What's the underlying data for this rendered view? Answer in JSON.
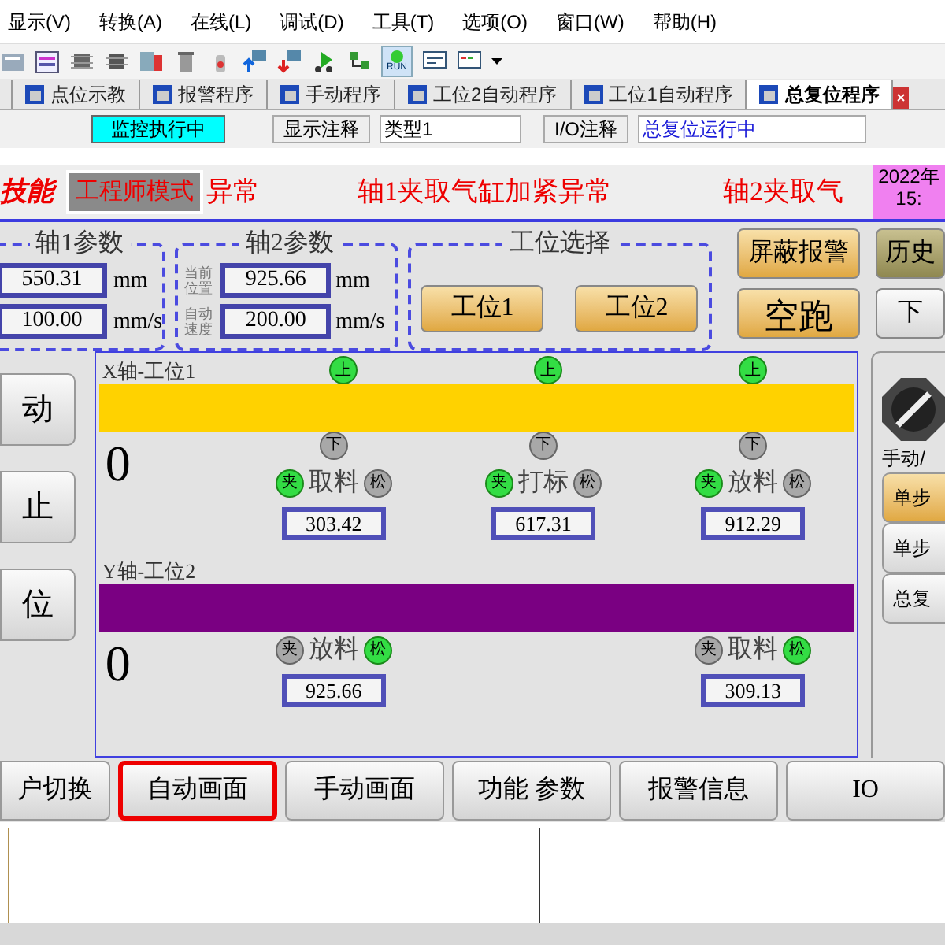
{
  "menu": [
    "显示(V)",
    "转换(A)",
    "在线(L)",
    "调试(D)",
    "工具(T)",
    "选项(O)",
    "窗口(W)",
    "帮助(H)"
  ],
  "toolbar": {
    "run_label": "RUN"
  },
  "tabs": [
    {
      "label": "点位示教",
      "selected": false
    },
    {
      "label": "报警程序",
      "selected": false
    },
    {
      "label": "手动程序",
      "selected": false
    },
    {
      "label": "工位2自动程序",
      "selected": false
    },
    {
      "label": "工位1自动程序",
      "selected": false
    },
    {
      "label": "总复位程序",
      "selected": true
    }
  ],
  "monitor": {
    "status": "监控执行中",
    "comment_button": "显示注释",
    "type_select": "类型1",
    "io_button": "I/O注释",
    "message": "总复位运行中"
  },
  "alarm_bar": {
    "logo_text": "技能",
    "mode_button": "工程师模式",
    "messages": [
      "异常",
      "轴1夹取气缸加紧异常",
      "轴2夹取气"
    ],
    "date": "2022年",
    "time": "15:"
  },
  "axis1": {
    "title": "轴1参数",
    "fields": [
      {
        "value": "550.31",
        "unit": "mm"
      },
      {
        "value": "100.00",
        "unit": "mm/s"
      }
    ]
  },
  "axis2": {
    "title": "轴2参数",
    "fields": [
      {
        "label": "当前位置",
        "value": "925.66",
        "unit": "mm"
      },
      {
        "label": "自动速度",
        "value": "200.00",
        "unit": "mm/s"
      }
    ]
  },
  "station_select": {
    "title": "工位选择",
    "buttons": [
      "工位1",
      "工位2"
    ]
  },
  "top_buttons": [
    {
      "label": "屏蔽报警",
      "kind": "gold"
    },
    {
      "label": "历史",
      "kind": "olive"
    },
    {
      "label": "空跑",
      "kind": "gold"
    },
    {
      "label": "下",
      "kind": "gray"
    }
  ],
  "control_buttons": [
    "动",
    "止",
    "位"
  ],
  "sections": [
    {
      "title": "X轴-工位1",
      "color": "#ffd200",
      "count": "0",
      "stations": [
        {
          "upper": {
            "text": "上",
            "on": true
          },
          "lower": {
            "text": "下",
            "on": false
          },
          "clamp": {
            "text": "夹",
            "on": true
          },
          "release": {
            "text": "松",
            "on": false
          },
          "name": "取料",
          "value": "303.42"
        },
        {
          "upper": {
            "text": "上",
            "on": true
          },
          "lower": {
            "text": "下",
            "on": false
          },
          "clamp": {
            "text": "夹",
            "on": true
          },
          "release": {
            "text": "松",
            "on": false
          },
          "name": "打标",
          "value": "617.31"
        },
        {
          "upper": {
            "text": "上",
            "on": true
          },
          "lower": {
            "text": "下",
            "on": false
          },
          "clamp": {
            "text": "夹",
            "on": true
          },
          "release": {
            "text": "松",
            "on": false
          },
          "name": "放料",
          "value": "912.29"
        }
      ]
    },
    {
      "title": "Y轴-工位2",
      "color": "#7a0082",
      "count": "0",
      "stations": [
        {
          "clamp": {
            "text": "夹",
            "on": false
          },
          "release": {
            "text": "松",
            "on": true
          },
          "name": "放料",
          "value": "925.66"
        },
        {
          "clamp": {
            "text": "夹",
            "on": false
          },
          "release": {
            "text": "松",
            "on": true
          },
          "name": "取料",
          "value": "309.13"
        }
      ]
    }
  ],
  "mode_panel": {
    "label": "手动/",
    "buttons": [
      {
        "label": "单步",
        "kind": "gold"
      },
      {
        "label": "单步",
        "kind": "gray"
      },
      {
        "label": "总复",
        "kind": "gray"
      }
    ]
  },
  "nav": [
    {
      "label": "户切换",
      "selected": false
    },
    {
      "label": "自动画面",
      "selected": true
    },
    {
      "label": "手动画面",
      "selected": false
    },
    {
      "label": "功能 参数",
      "selected": false
    },
    {
      "label": "报警信息",
      "selected": false
    },
    {
      "label": "IO",
      "selected": false
    }
  ]
}
